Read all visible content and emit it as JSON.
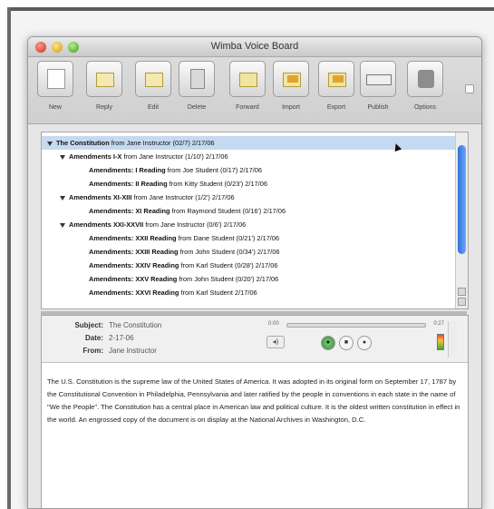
{
  "window": {
    "title": "Wimba Voice Board"
  },
  "toolbar": {
    "buttons": [
      {
        "label": "New"
      },
      {
        "label": "Reply"
      },
      {
        "label": "Edit"
      },
      {
        "label": "Delete"
      },
      {
        "label": "Forward"
      },
      {
        "label": "Import"
      },
      {
        "label": "Export"
      },
      {
        "label": "Publish"
      },
      {
        "label": "Options"
      }
    ]
  },
  "threads": [
    {
      "title": "The Constitution",
      "rest": " from Jane Instructor (02/7) 2/17/06",
      "level": 0,
      "expanded": true,
      "selected": true
    },
    {
      "title": "Amendments I-X",
      "rest": " from Jane Instructor (1/10') 2/17/06",
      "level": 1,
      "expanded": true,
      "selected": false
    },
    {
      "title": "Amendments: I Reading",
      "rest": " from Joe Student (0/17) 2/17/06",
      "level": 2,
      "expanded": false,
      "selected": false
    },
    {
      "title": "Amendments: II Reading",
      "rest": " from Kitty Student (0/23') 2/17/06",
      "level": 2,
      "expanded": false,
      "selected": false
    },
    {
      "title": "Amendments XI-XIII",
      "rest": " from Jane Instructor (1/2') 2/17/06",
      "level": 1,
      "expanded": true,
      "selected": false
    },
    {
      "title": "Amendments: XI Reading",
      "rest": " from Raymond Student (0/16') 2/17/06",
      "level": 2,
      "expanded": false,
      "selected": false
    },
    {
      "title": "Amendments XXI-XXVII",
      "rest": " from Jane Instructor (0/6') 2/17/06",
      "level": 1,
      "expanded": true,
      "selected": false
    },
    {
      "title": "Amendments: XXII Reading",
      "rest": " from Dane Student (0/21') 2/17/06",
      "level": 2,
      "expanded": false,
      "selected": false
    },
    {
      "title": "Amendments: XXIII Reading",
      "rest": " from John Student (0/34') 2/17/06",
      "level": 2,
      "expanded": false,
      "selected": false
    },
    {
      "title": "Amendments: XXIV Reading",
      "rest": " from Karl Student (0/28') 2/17/06",
      "level": 2,
      "expanded": false,
      "selected": false
    },
    {
      "title": "Amendments: XXV Reading",
      "rest": " from John Student (0/20') 2/17/06",
      "level": 2,
      "expanded": false,
      "selected": false
    },
    {
      "title": "Amendments: XXVI Reading",
      "rest": " from Karl Student 2/17/06",
      "level": 2,
      "expanded": false,
      "selected": false
    }
  ],
  "message": {
    "subject_label": "Subject:",
    "subject": "The Constitution",
    "date_label": "Date:",
    "date": "2-17-06",
    "from_label": "From:",
    "from": "Jane Instructor",
    "player": {
      "time_elapsed": "0:00",
      "time_total": "0:27",
      "progress": 0.0
    },
    "body": "The U.S. Constitution is the supreme law of the United States of America. It was adopted in its original form on September 17, 1787 by the Constitutional Convention in Philadelphia, Pennsylvania and later ratified by the people in conventions in each state in the name of \"We the People\". The Constitution has a central place in American law and political culture. It is the oldest written constitution in effect in the world. An engrossed copy of the document is on display at the National Archives in Washington, D.C."
  }
}
